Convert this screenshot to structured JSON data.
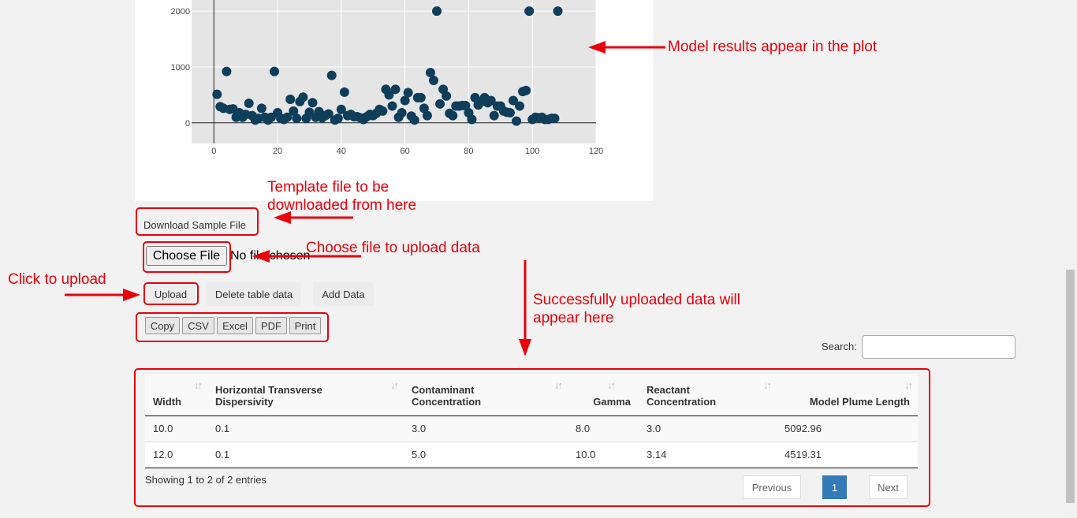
{
  "chart_data": {
    "type": "scatter",
    "title": "",
    "xlabel": "",
    "ylabel": "",
    "xlim": [
      -7,
      120
    ],
    "ylim": [
      -370,
      2200
    ],
    "xticks": [
      0,
      20,
      40,
      60,
      80,
      100,
      120
    ],
    "yticks": [
      0,
      1000,
      2000
    ],
    "x_tick_labels": [
      "0",
      "20",
      "40",
      "60",
      "80",
      "100",
      "120"
    ],
    "y_tick_labels": [
      "0",
      "1000",
      "2000"
    ],
    "grid": true,
    "marker_color": "#0e3e5a",
    "background_color": "#e5e5e5",
    "points": [
      [
        1,
        510
      ],
      [
        2,
        290
      ],
      [
        3,
        260
      ],
      [
        4,
        920
      ],
      [
        5,
        240
      ],
      [
        6,
        250
      ],
      [
        7,
        100
      ],
      [
        8,
        180
      ],
      [
        9,
        100
      ],
      [
        10,
        150
      ],
      [
        11,
        350
      ],
      [
        12,
        130
      ],
      [
        13,
        50
      ],
      [
        14,
        80
      ],
      [
        15,
        260
      ],
      [
        16,
        100
      ],
      [
        17,
        50
      ],
      [
        18,
        100
      ],
      [
        19,
        920
      ],
      [
        20,
        180
      ],
      [
        21,
        80
      ],
      [
        22,
        60
      ],
      [
        23,
        100
      ],
      [
        24,
        420
      ],
      [
        25,
        210
      ],
      [
        26,
        80
      ],
      [
        27,
        380
      ],
      [
        28,
        460
      ],
      [
        29,
        80
      ],
      [
        30,
        190
      ],
      [
        31,
        360
      ],
      [
        32,
        100
      ],
      [
        33,
        200
      ],
      [
        34,
        90
      ],
      [
        35,
        130
      ],
      [
        36,
        160
      ],
      [
        37,
        850
      ],
      [
        38,
        50
      ],
      [
        39,
        80
      ],
      [
        40,
        240
      ],
      [
        41,
        550
      ],
      [
        42,
        130
      ],
      [
        43,
        150
      ],
      [
        44,
        110
      ],
      [
        45,
        110
      ],
      [
        46,
        90
      ],
      [
        47,
        60
      ],
      [
        48,
        110
      ],
      [
        49,
        150
      ],
      [
        50,
        130
      ],
      [
        51,
        170
      ],
      [
        52,
        240
      ],
      [
        53,
        210
      ],
      [
        54,
        600
      ],
      [
        55,
        500
      ],
      [
        56,
        300
      ],
      [
        57,
        600
      ],
      [
        58,
        100
      ],
      [
        59,
        180
      ],
      [
        60,
        400
      ],
      [
        61,
        540
      ],
      [
        62,
        120
      ],
      [
        63,
        50
      ],
      [
        64,
        450
      ],
      [
        65,
        450
      ],
      [
        66,
        260
      ],
      [
        67,
        130
      ],
      [
        68,
        900
      ],
      [
        69,
        760
      ],
      [
        70,
        2000
      ],
      [
        71,
        340
      ],
      [
        72,
        600
      ],
      [
        73,
        480
      ],
      [
        74,
        170
      ],
      [
        75,
        130
      ],
      [
        76,
        300
      ],
      [
        77,
        300
      ],
      [
        78,
        310
      ],
      [
        79,
        310
      ],
      [
        80,
        180
      ],
      [
        81,
        60
      ],
      [
        82,
        450
      ],
      [
        83,
        320
      ],
      [
        84,
        380
      ],
      [
        85,
        450
      ],
      [
        86,
        360
      ],
      [
        87,
        400
      ],
      [
        88,
        130
      ],
      [
        89,
        300
      ],
      [
        90,
        300
      ],
      [
        91,
        210
      ],
      [
        92,
        190
      ],
      [
        93,
        180
      ],
      [
        94,
        400
      ],
      [
        95,
        30
      ],
      [
        96,
        300
      ],
      [
        97,
        560
      ],
      [
        98,
        580
      ],
      [
        99,
        2000
      ],
      [
        100,
        60
      ],
      [
        101,
        100
      ],
      [
        102,
        90
      ],
      [
        103,
        100
      ],
      [
        104,
        60
      ],
      [
        105,
        60
      ],
      [
        106,
        80
      ],
      [
        107,
        80
      ],
      [
        108,
        2000
      ]
    ]
  },
  "annotations": {
    "plot": "Model results appear in the plot",
    "template_line1": "Template file to be",
    "template_line2": "downloaded from here",
    "choose": "Choose file to upload data",
    "upload": "Click to upload",
    "success_line1": "Successfully uploaded data will",
    "success_line2": "appear here",
    "color": "#e8000b"
  },
  "controls": {
    "download_sample": "Download Sample File",
    "choose_file": "Choose File",
    "no_file": "No file chosen",
    "upload": "Upload",
    "delete_table": "Delete table data",
    "add_data": "Add Data"
  },
  "export_buttons": [
    "Copy",
    "CSV",
    "Excel",
    "PDF",
    "Print"
  ],
  "search": {
    "label": "Search:",
    "value": ""
  },
  "table": {
    "headers": [
      [
        "Width"
      ],
      [
        "Horizontal Transverse",
        "Dispersivity"
      ],
      [
        "Contaminant",
        "Concentration"
      ],
      [
        "Gamma"
      ],
      [
        "Reactant",
        "Concentration"
      ],
      [
        "Model Plume Length"
      ]
    ],
    "rows": [
      [
        "10.0",
        "0.1",
        "3.0",
        "8.0",
        "3.0",
        "5092.96"
      ],
      [
        "12.0",
        "0.1",
        "5.0",
        "10.0",
        "3.14",
        "4519.31"
      ]
    ],
    "info": "Showing 1 to 2 of 2 entries"
  },
  "pagination": {
    "previous": "Previous",
    "page": "1",
    "next": "Next",
    "active_color": "#337ab7"
  }
}
